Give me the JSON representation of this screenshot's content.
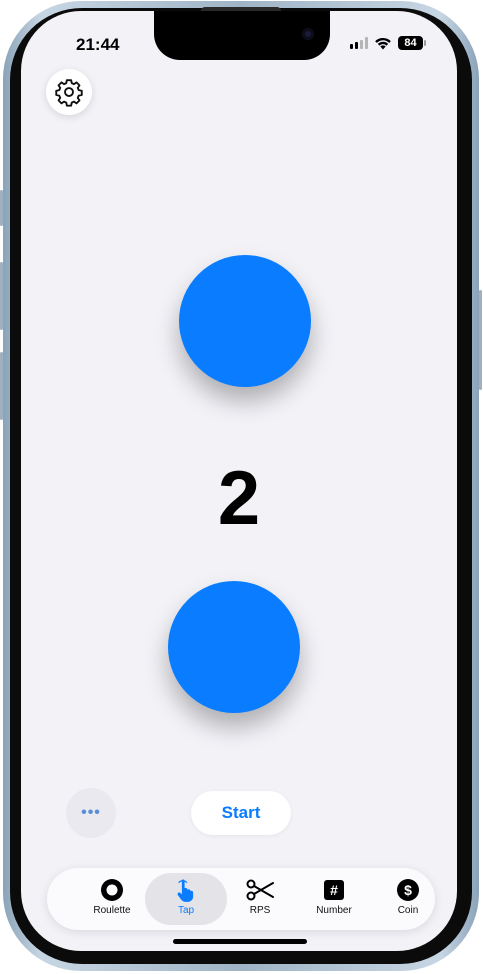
{
  "status_bar": {
    "time": "21:44",
    "battery": "84"
  },
  "game": {
    "count": "2"
  },
  "controls": {
    "more_label": "•••",
    "start_label": "Start"
  },
  "tabs": [
    {
      "label": "Roulette",
      "icon": "roulette-icon",
      "active": false
    },
    {
      "label": "Tap",
      "icon": "tap-hand-icon",
      "active": true
    },
    {
      "label": "RPS",
      "icon": "scissors-icon",
      "active": false
    },
    {
      "label": "Number",
      "icon": "number-icon",
      "active": false
    },
    {
      "label": "Coin",
      "icon": "coin-icon",
      "active": false
    }
  ],
  "colors": {
    "accent": "#0a7cff",
    "background": "#f2f2f7",
    "tab_active_bg": "#e3e3e8"
  }
}
